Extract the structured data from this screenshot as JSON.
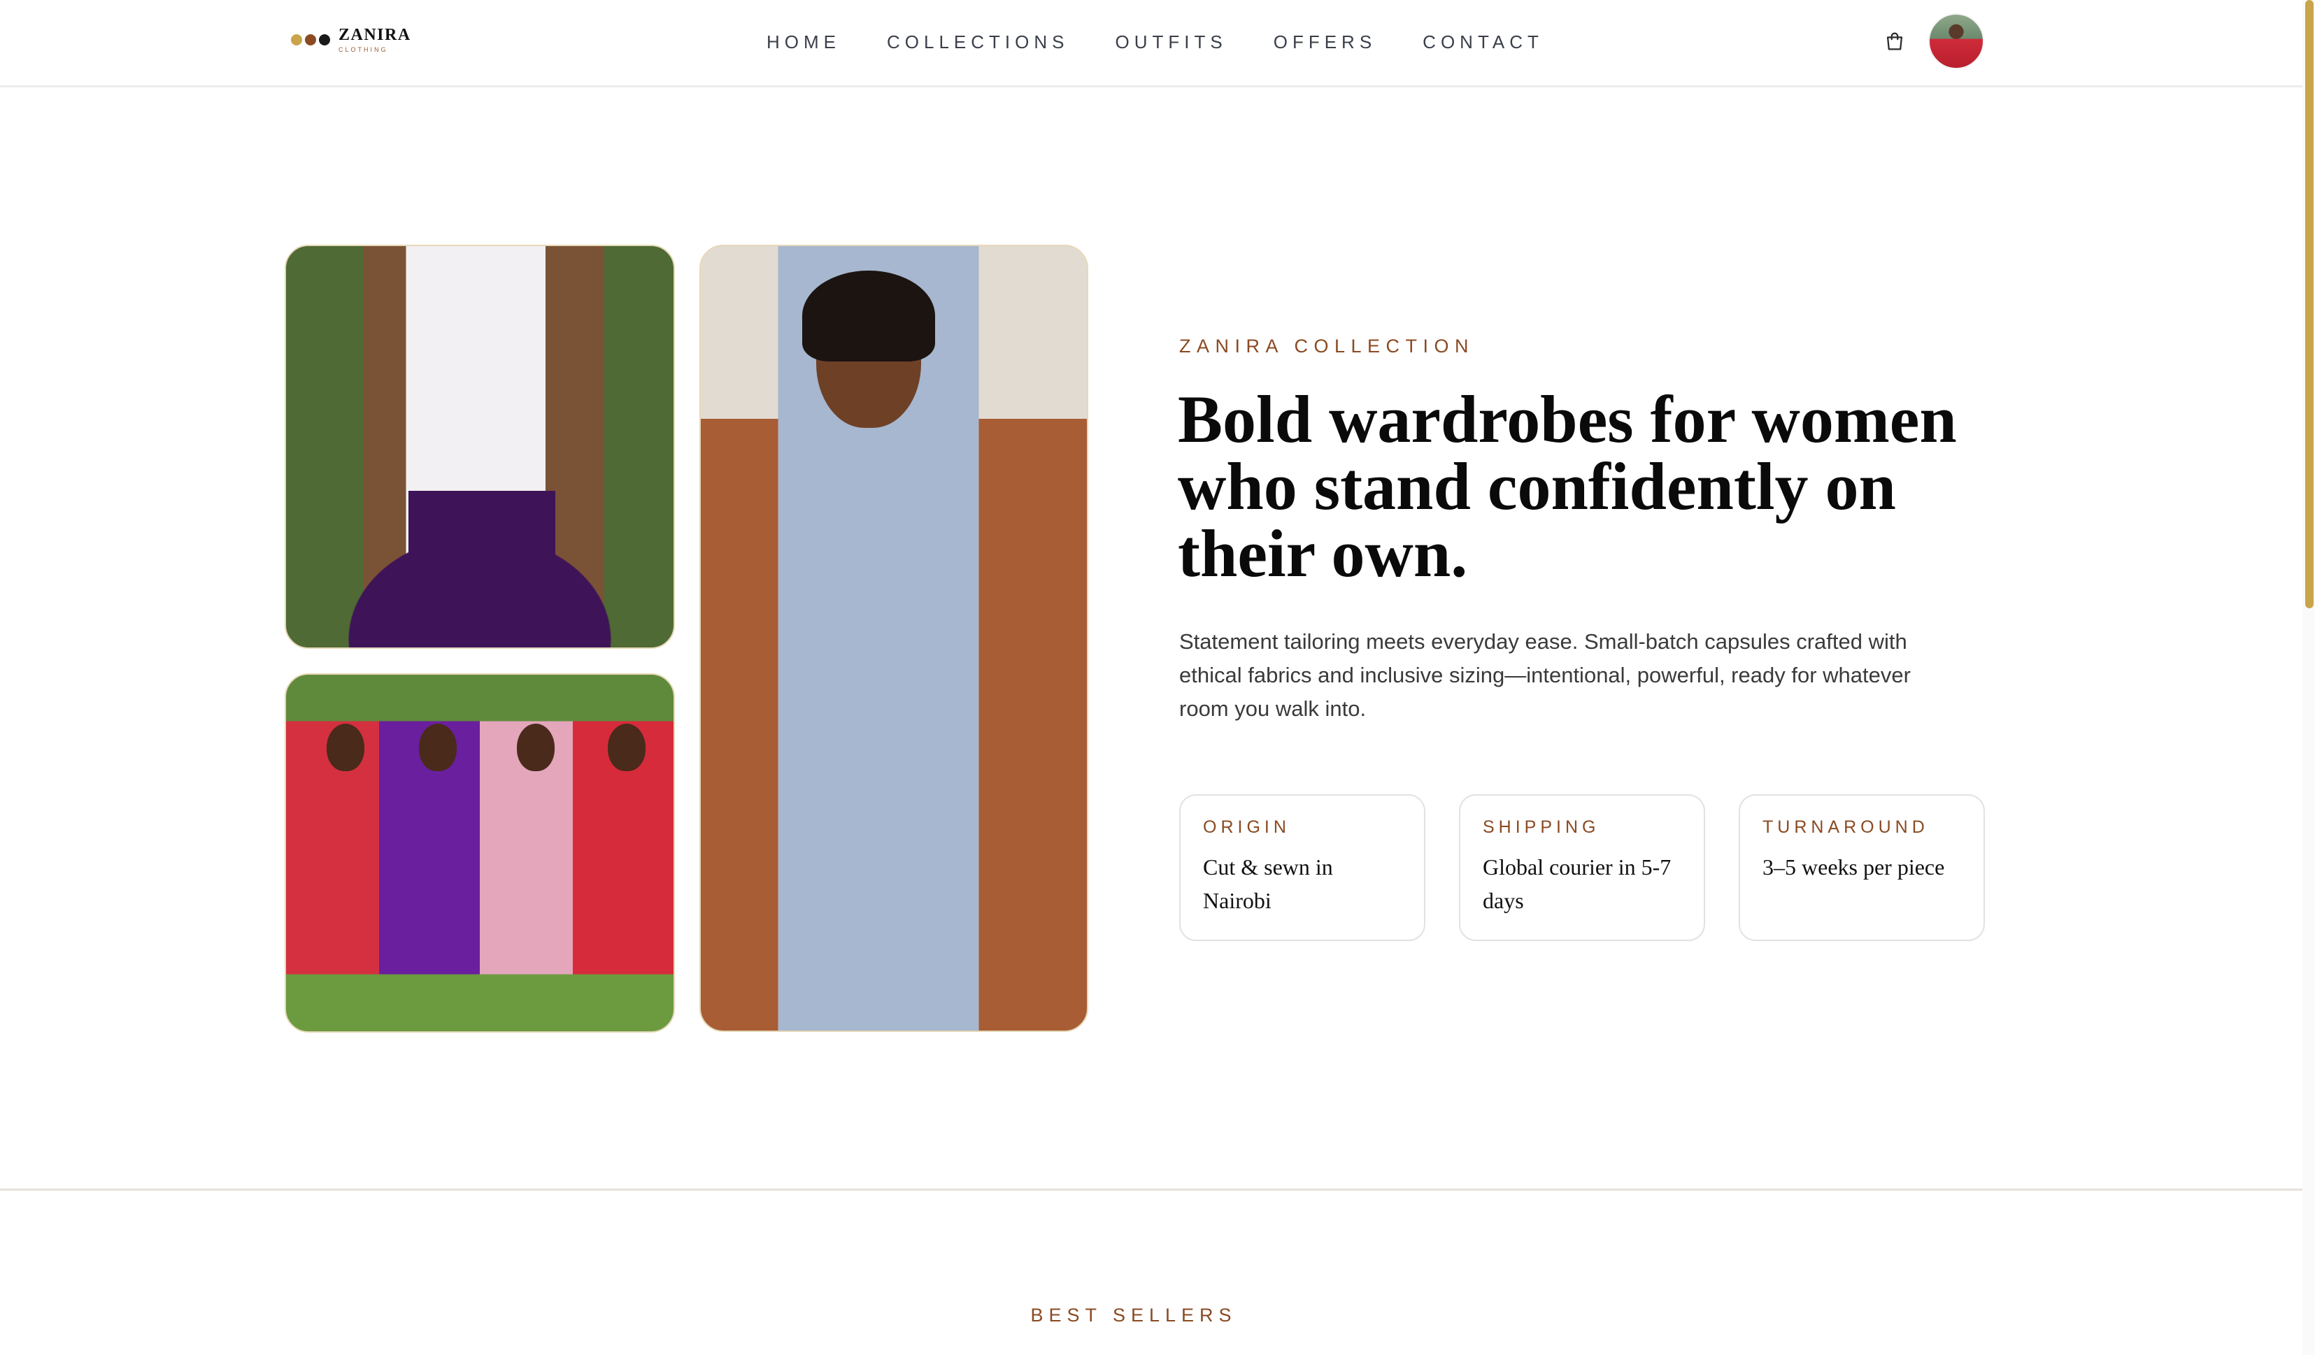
{
  "brand": {
    "name": "ZANIRA",
    "tagline": "CLOTHING",
    "dot_colors": [
      "#c9a44a",
      "#8a4a22",
      "#1a1a1a"
    ]
  },
  "nav": {
    "items": [
      {
        "label": "HOME"
      },
      {
        "label": "COLLECTIONS"
      },
      {
        "label": "OUTFITS"
      },
      {
        "label": "OFFERS"
      },
      {
        "label": "CONTACT"
      }
    ]
  },
  "header_icons": {
    "cart": "shopping-bag-icon",
    "avatar": "user-avatar"
  },
  "hero": {
    "eyebrow": "ZANIRA COLLECTION",
    "headline": "Bold wardrobes for women who stand confidently on their own.",
    "lead": "Statement tailoring meets everyday ease. Small-batch capsules crafted with ethical fabrics and inclusive sizing—intentional, powerful, ready for whatever room you walk into.",
    "facts": [
      {
        "label": "ORIGIN",
        "value": "Cut & sewn in Nairobi"
      },
      {
        "label": "SHIPPING",
        "value": "Global courier in 5-7 days"
      },
      {
        "label": "TURNAROUND",
        "value": "3–5 weeks per piece"
      }
    ]
  },
  "sections": {
    "best_sellers": "BEST SELLERS"
  },
  "colors": {
    "accent": "#c9a44a",
    "eyebrow": "#8a4a22",
    "headline": "#0a0a0a"
  }
}
